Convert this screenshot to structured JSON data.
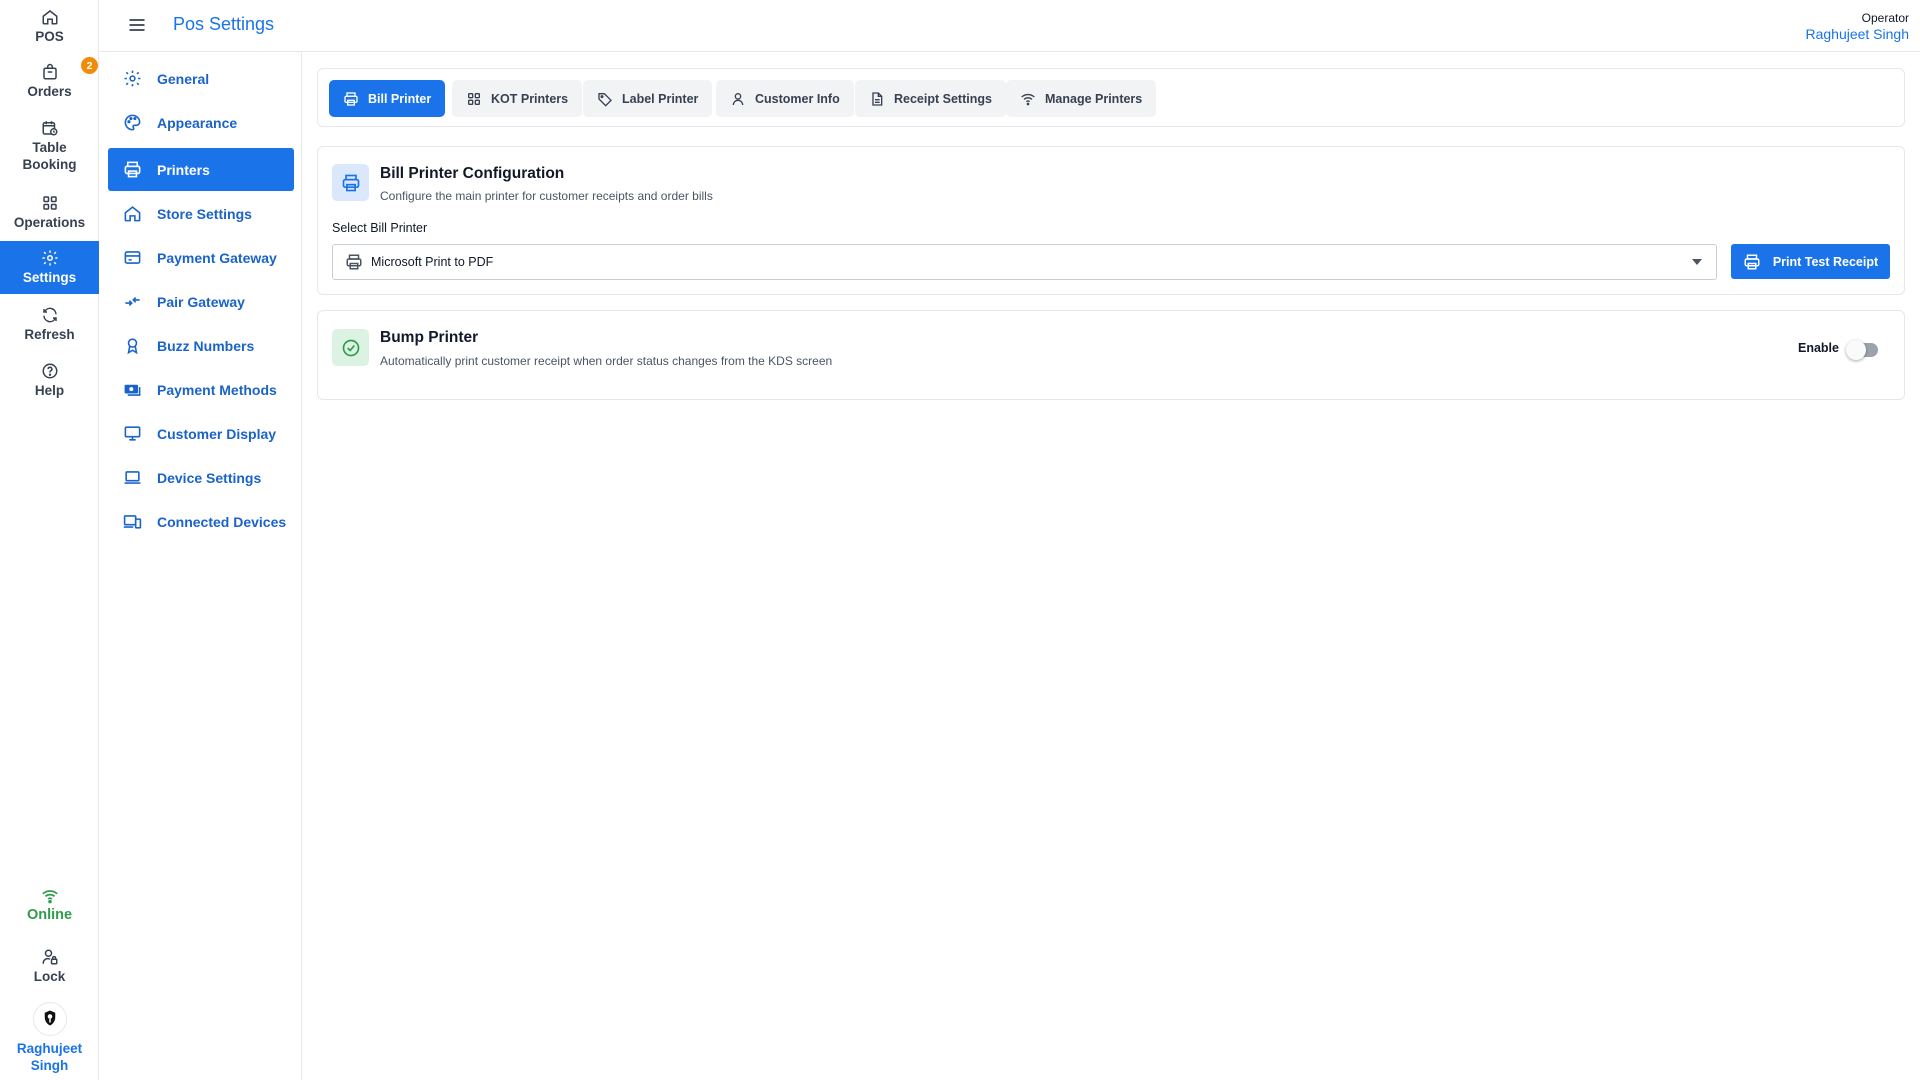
{
  "colors": {
    "accent": "#1a73e8",
    "online": "#2e9d4a",
    "badge": "#f28b0c"
  },
  "rail": {
    "items": [
      {
        "label": "POS",
        "icon": "home-icon"
      },
      {
        "label": "Orders",
        "icon": "shopping-bag-icon",
        "badge": "2"
      },
      {
        "label": "Table Booking",
        "icon": "calendar-clock-icon"
      },
      {
        "label": "Operations",
        "icon": "grid-icon"
      },
      {
        "label": "Settings",
        "icon": "gear-icon",
        "active": true
      },
      {
        "label": "Refresh",
        "icon": "refresh-icon"
      },
      {
        "label": "Help",
        "icon": "help-icon"
      }
    ],
    "status": "Online",
    "lock": "Lock",
    "user": "Raghujeet Singh"
  },
  "header": {
    "title": "Pos Settings",
    "operator_role": "Operator",
    "operator_name": "Raghujeet Singh"
  },
  "sidebar": {
    "items": [
      {
        "label": "General",
        "icon": "gear-icon"
      },
      {
        "label": "Appearance",
        "icon": "palette-icon"
      },
      {
        "label": "Printers",
        "icon": "printer-icon",
        "active": true
      },
      {
        "label": "Store Settings",
        "icon": "home-icon"
      },
      {
        "label": "Payment Gateway",
        "icon": "credit-card-icon"
      },
      {
        "label": "Pair Gateway",
        "icon": "pair-arrows-icon"
      },
      {
        "label": "Buzz Numbers",
        "icon": "award-icon"
      },
      {
        "label": "Payment Methods",
        "icon": "cash-icon"
      },
      {
        "label": "Customer Display",
        "icon": "monitor-icon"
      },
      {
        "label": "Device Settings",
        "icon": "laptop-icon"
      },
      {
        "label": "Connected Devices",
        "icon": "devices-icon"
      }
    ]
  },
  "tabs": [
    {
      "label": "Bill Printer",
      "icon": "printer-icon",
      "active": true
    },
    {
      "label": "KOT Printers",
      "icon": "grid-icon"
    },
    {
      "label": "Label Printer",
      "icon": "tag-icon"
    },
    {
      "label": "Customer Info",
      "icon": "user-icon"
    },
    {
      "label": "Receipt Settings",
      "icon": "document-icon"
    },
    {
      "label": "Manage Printers",
      "icon": "wifi-icon"
    }
  ],
  "bill_printer": {
    "title": "Bill Printer Configuration",
    "description": "Configure the main printer for customer receipts and order bills",
    "select_label": "Select Bill Printer",
    "selected_printer": "Microsoft Print to PDF",
    "test_button": "Print Test Receipt"
  },
  "bump_printer": {
    "title": "Bump Printer",
    "description": "Automatically print customer receipt when order status changes from the KDS screen",
    "toggle_label": "Enable",
    "enabled": false
  }
}
